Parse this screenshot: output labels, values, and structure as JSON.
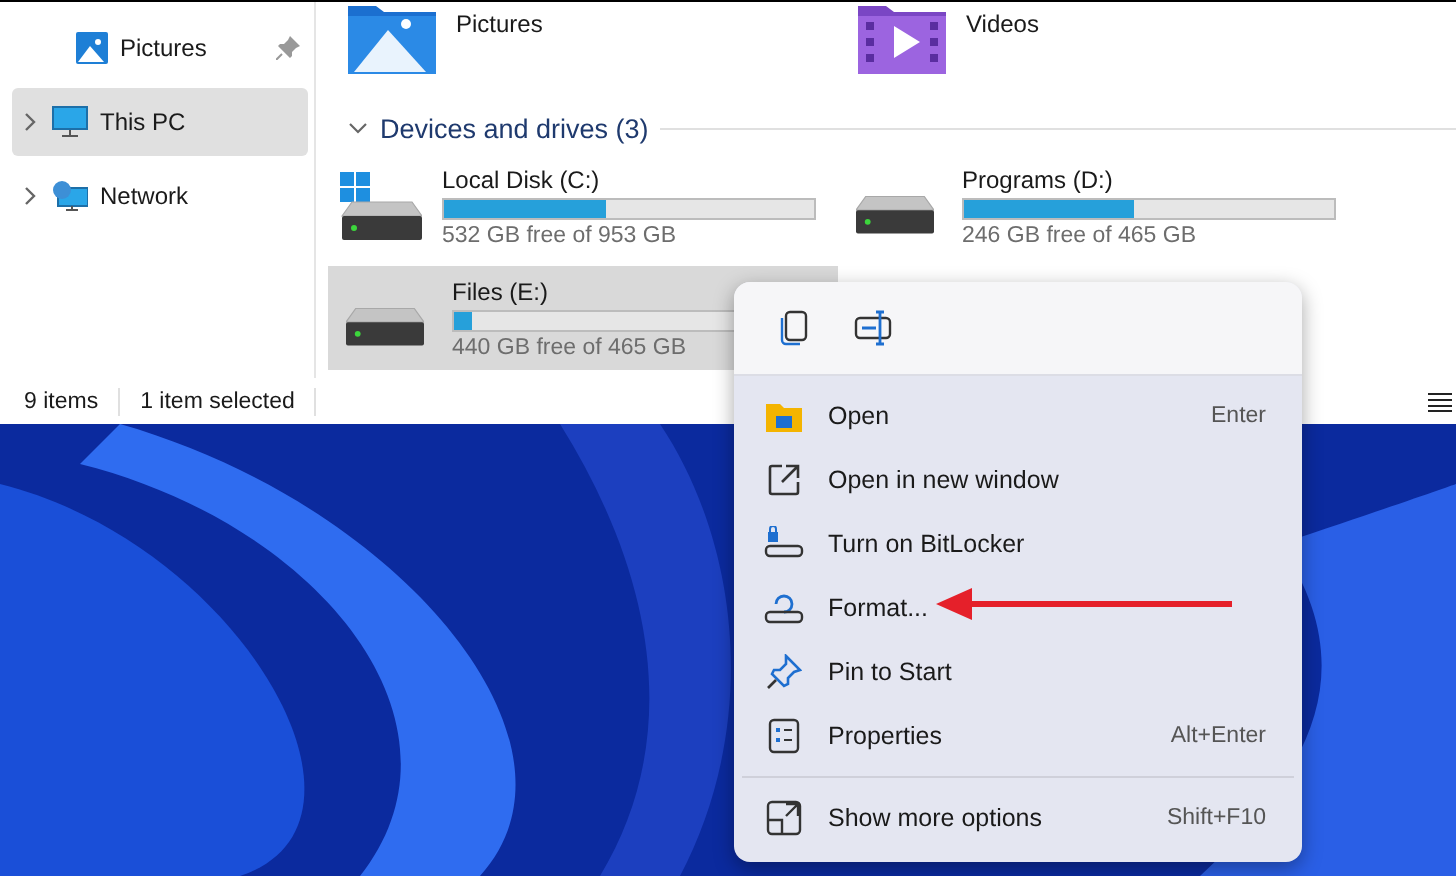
{
  "sidebar": {
    "items": [
      {
        "label": "Pictures",
        "pinned": true,
        "selected": false,
        "expandable": false
      },
      {
        "label": "This PC",
        "pinned": false,
        "selected": true,
        "expandable": true
      },
      {
        "label": "Network",
        "pinned": false,
        "selected": false,
        "expandable": true
      }
    ]
  },
  "folders": [
    {
      "label": "Pictures",
      "kind": "pictures"
    },
    {
      "label": "Videos",
      "kind": "videos"
    }
  ],
  "section": {
    "title": "Devices and drives (3)",
    "expanded": true
  },
  "drives": [
    {
      "name": "Local Disk (C:)",
      "kind": "system",
      "level": 0.44,
      "free": "532 GB free of 953 GB",
      "selected": false
    },
    {
      "name": "Programs  (D:)",
      "kind": "data",
      "level": 0.46,
      "free": "246 GB free of 465 GB",
      "selected": false
    },
    {
      "name": "Files (E:)",
      "kind": "data",
      "level": 0.05,
      "free": "440 GB free of 465 GB",
      "selected": true
    }
  ],
  "status_bar": {
    "count": "9 items",
    "selection": "1 item selected"
  },
  "context_menu": {
    "items": [
      {
        "label": "Open",
        "shortcut": "Enter"
      },
      {
        "label": "Open in new window"
      },
      {
        "label": "Turn on BitLocker"
      },
      {
        "label": "Format..."
      },
      {
        "label": "Pin to Start"
      },
      {
        "label": "Properties",
        "shortcut": "Alt+Enter"
      },
      {
        "label": "Show more options",
        "shortcut": "Shift+F10"
      }
    ]
  }
}
